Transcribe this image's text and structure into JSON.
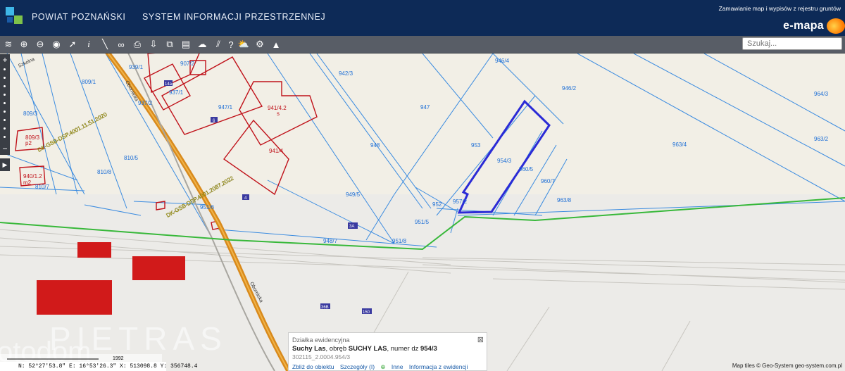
{
  "header": {
    "org_name": "POWIAT POZNAŃSKI",
    "system_name": "SYSTEM INFORMACJI PRZESTRZENNEJ",
    "order_link": "Zamawianie map i wypisów z rejestru gruntów",
    "brand": "e-mapa"
  },
  "toolbar": {
    "icons": [
      "layers-icon",
      "zoom-in-icon",
      "zoom-out-icon",
      "zoom-extent-icon",
      "select-arrow-icon",
      "info-icon",
      "measure-line-icon",
      "link-icon",
      "print-icon",
      "download-icon",
      "export-icon",
      "layout-icon",
      "cloud-icon",
      "hatch-icon",
      "help-icon",
      "cloud-download-icon",
      "settings-icon",
      "road-icon"
    ],
    "search_placeholder": "Szukaj..."
  },
  "parcels": {
    "blue": [
      "946/4",
      "942/3",
      "946/2",
      "964/3",
      "809/1",
      "907/2",
      "937/1",
      "947/1",
      "947",
      "809/3",
      "939/1",
      "963/4",
      "963/2",
      "810/5",
      "953",
      "954/3",
      "960/5",
      "948",
      "960/7",
      "810/8",
      "810/7",
      "949/5",
      "963/8",
      "952",
      "951/6",
      "951/5",
      "948/7",
      "951/8",
      "957/2",
      "937/2"
    ],
    "red": [
      "941/4.2",
      "s",
      "941/4",
      "809/3",
      "p2",
      "940/1.2",
      "m2"
    ]
  },
  "building_badges": [
    "14a",
    "6",
    "4",
    "3A",
    "36B",
    "150"
  ],
  "road_labels": [
    "Szkolna",
    "Obornicka",
    "DK-GSB-DSP.4001.11.51.2020",
    "DK-GSB-DSP.4001.2087.2022"
  ],
  "popup": {
    "type_label": "Działka ewidencyjna",
    "location": "Suchy Las",
    "precinct_prefix": ", obręb ",
    "precinct": "SUCHY LAS",
    "number_prefix": ", numer dz ",
    "number": "954/3",
    "identifier": "302115_2.0004.954/3",
    "links": [
      "Zbliż do obiektu",
      "Szczegóły (I)",
      "Inne",
      "Informacja z ewidencji"
    ]
  },
  "coords": "N: 52°27'53.8\"  E: 16°53'26.3\"  X: 513098.8  Y: 356748.4",
  "scale_label": "1992",
  "attribution": "Map tiles © Geo-System geo-system.com.pl",
  "watermark": "PIETRAS",
  "watermark2": "otodom",
  "colors": {
    "header_bg": "#0d2a57",
    "toolbar_bg": "#585d66",
    "parcel_lines": "#3a8be0",
    "building_outline": "#c0121a",
    "selected_parcel": "#2b2bd6",
    "boundary_green": "#38b83a",
    "road": "#d98a1c",
    "block_red": "#d11a1a"
  }
}
